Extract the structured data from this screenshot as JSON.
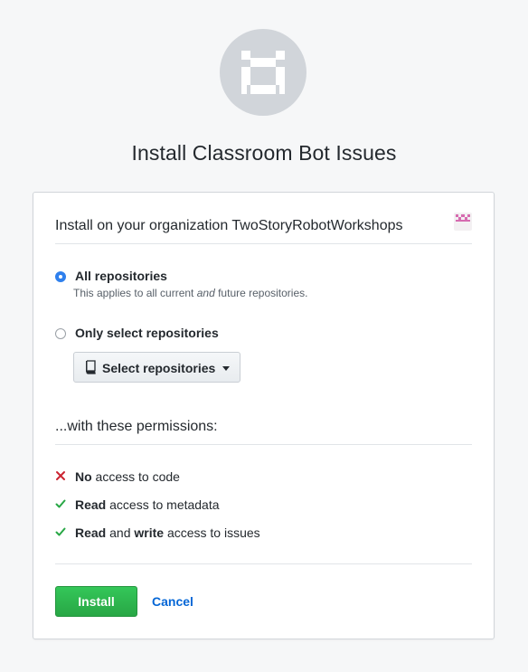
{
  "app": {
    "icon": "identicon-app-avatar",
    "title": "Install Classroom Bot Issues"
  },
  "org": {
    "install_text": "Install on your organization TwoStoryRobotWorkshops",
    "avatar_icon": "identicon-org-avatar"
  },
  "repo_options": {
    "all": {
      "label": "All repositories",
      "note_before": "This applies to all current ",
      "note_em": "and",
      "note_after": " future repositories.",
      "selected": true
    },
    "select": {
      "label": "Only select repositories",
      "selected": false
    },
    "select_button": {
      "label": "Select repositories",
      "icon": "repo-icon",
      "caret_icon": "caret-down-icon"
    }
  },
  "permissions": {
    "heading": "...with these permissions:",
    "items": [
      {
        "icon": "x-icon",
        "bold": "No",
        "rest": " access to code",
        "color": "#cb2431"
      },
      {
        "icon": "check-icon",
        "bold": "Read",
        "rest": " access to metadata",
        "color": "#28a745"
      },
      {
        "icon": "check-icon",
        "bold": "Read",
        "mid": " and ",
        "bold2": "write",
        "rest": " access to issues",
        "color": "#28a745"
      }
    ]
  },
  "actions": {
    "install_label": "Install",
    "cancel_label": "Cancel"
  },
  "colors": {
    "accent_green": "#28a745",
    "link_blue": "#0366d6",
    "radio_blue": "#2f80ed",
    "deny_red": "#cb2431"
  }
}
